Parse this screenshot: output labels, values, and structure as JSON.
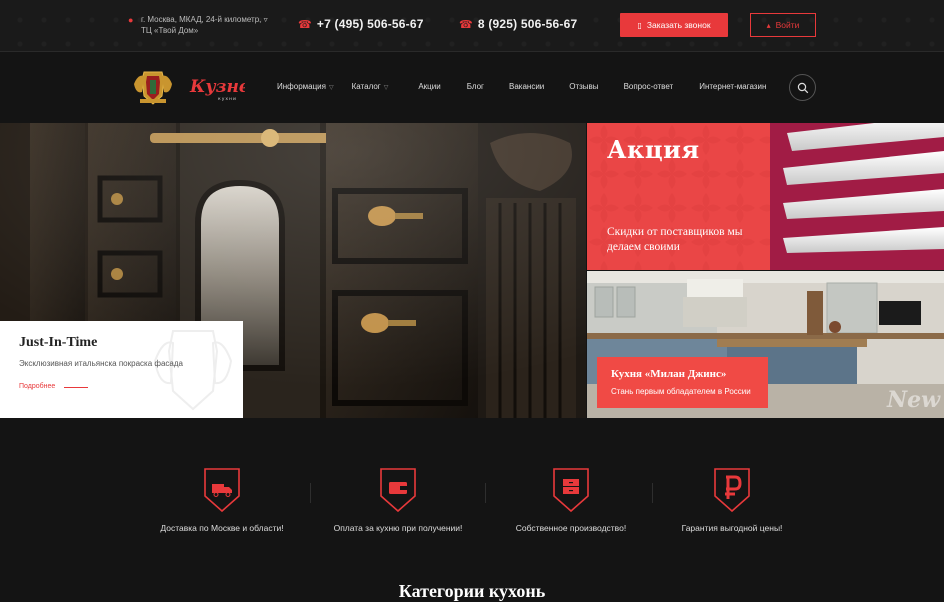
{
  "header": {
    "address": "г. Москва, МКАД, 24-й километр, ▿ ТЦ «Твой Дом»",
    "phone1": "+7 (495) 506-56-67",
    "phone2": "8 (925) 506-56-67",
    "call_button": "Заказать звонок",
    "login_button": "Войти"
  },
  "logo": {
    "text": "Кузнец",
    "sub": "кухни"
  },
  "nav": {
    "items": [
      {
        "label": "Информация",
        "dropdown": true
      },
      {
        "label": "Каталог",
        "dropdown": true
      },
      {
        "label": "Акции",
        "dropdown": false
      },
      {
        "label": "Блог",
        "dropdown": false
      },
      {
        "label": "Вакансии",
        "dropdown": false
      },
      {
        "label": "Отзывы",
        "dropdown": false
      },
      {
        "label": "Вопрос-ответ",
        "dropdown": false
      },
      {
        "label": "Интернет-магазин",
        "dropdown": false
      }
    ],
    "search_icon": "search-icon"
  },
  "slider": {
    "title": "Just-In-Time",
    "subtitle": "Эксклюзивная итальянска покраска фасада",
    "more": "Подробнее",
    "slide_count": 8,
    "active_index": 2
  },
  "banner_sale": {
    "title": "Акция",
    "text": "Скидки от поставщиков мы делаем своими"
  },
  "banner_kitchen": {
    "title": "Кухня «Милан Джинс»",
    "text": "Стань первым обладателем в России",
    "badge": "New"
  },
  "features": [
    {
      "icon": "truck-icon",
      "label": "Доставка по Москве и области!"
    },
    {
      "icon": "wallet-icon",
      "label": "Оплата за кухню при получении!"
    },
    {
      "icon": "factory-icon",
      "label": "Собственное производство!"
    },
    {
      "icon": "ruble-icon",
      "label": "Гарантия выгодной цены!"
    }
  ],
  "section_title": "Категории кухонь",
  "colors": {
    "accent": "#e8393b",
    "bg": "#141414"
  }
}
